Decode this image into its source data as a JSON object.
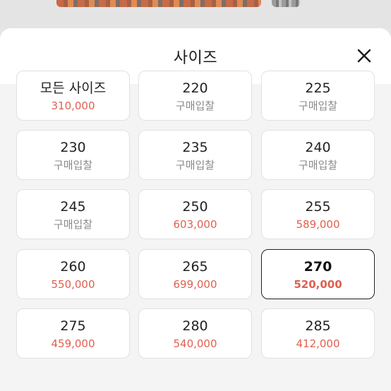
{
  "sheet": {
    "title": "사이즈",
    "close_label": "×"
  },
  "colors": {
    "price_red": "#e0604f",
    "bid_gray": "#8a8a8a",
    "selected_border": "#222222"
  },
  "sizes": [
    {
      "label": "모든 사이즈",
      "price": "310,000",
      "kind": "price"
    },
    {
      "label": "220",
      "price": "구매입찰",
      "kind": "bid"
    },
    {
      "label": "225",
      "price": "구매입찰",
      "kind": "bid"
    },
    {
      "label": "230",
      "price": "구매입찰",
      "kind": "bid"
    },
    {
      "label": "235",
      "price": "구매입찰",
      "kind": "bid"
    },
    {
      "label": "240",
      "price": "구매입찰",
      "kind": "bid"
    },
    {
      "label": "245",
      "price": "구매입찰",
      "kind": "bid"
    },
    {
      "label": "250",
      "price": "603,000",
      "kind": "price"
    },
    {
      "label": "255",
      "price": "589,000",
      "kind": "price"
    },
    {
      "label": "260",
      "price": "550,000",
      "kind": "price"
    },
    {
      "label": "265",
      "price": "699,000",
      "kind": "price"
    },
    {
      "label": "270",
      "price": "520,000",
      "kind": "price",
      "selected": true
    },
    {
      "label": "275",
      "price": "459,000",
      "kind": "price"
    },
    {
      "label": "280",
      "price": "540,000",
      "kind": "price"
    },
    {
      "label": "285",
      "price": "412,000",
      "kind": "price"
    }
  ]
}
